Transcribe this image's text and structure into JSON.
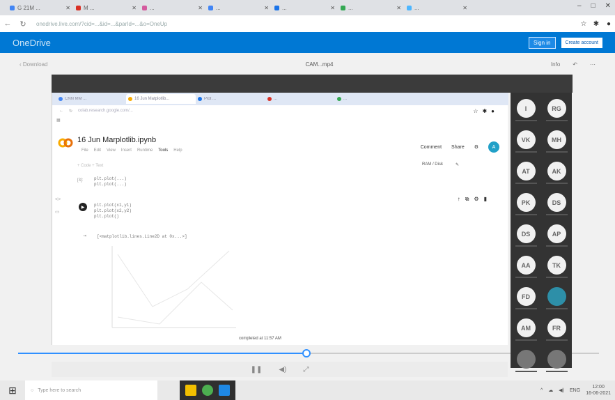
{
  "browser": {
    "tabs": [
      {
        "label": "G 21M ...",
        "color": "#4285f4"
      },
      {
        "label": "M ...",
        "color": "#d93025"
      },
      {
        "label": "...",
        "color": "#d45a9e"
      },
      {
        "label": "...",
        "color": "#4285f4"
      },
      {
        "label": "...",
        "color": "#1a73e8"
      },
      {
        "label": "...",
        "color": "#34a853"
      },
      {
        "label": "...",
        "color": "#4db6ff"
      }
    ],
    "url": "onedrive.live.com/?cid=...&id=...&parId=...&o=OneUp",
    "window_controls": {
      "minimize": "–",
      "restore": "□",
      "close": "✕"
    }
  },
  "onedrive": {
    "brand": "OneDrive",
    "sign_in": "Sign in",
    "create": "Create account"
  },
  "filebar": {
    "back": "‹ Download",
    "filename": "CAM...mp4",
    "info": "Info"
  },
  "inner": {
    "tabs": [
      "CNN MM ...",
      "16 Jun Matplotlib...",
      "Plot ...",
      "...",
      "..."
    ],
    "url": "colab.research.google.com/...",
    "notebook_title": "16 Jun Marplotlib.ipynb",
    "menus": [
      "File",
      "Edit",
      "View",
      "Insert",
      "Runtime",
      "Tools",
      "Help"
    ],
    "menu_strong": "Tools",
    "comment": "Comment",
    "share": "Share",
    "avatar": "A",
    "toolbar": "+ Code   + Text",
    "ram": "RAM / Disk",
    "cell1_num": "[3]:",
    "cell1_code": [
      "plt.plot(...)",
      "plt.plot(...)"
    ],
    "cell2_code": [
      "plt.plot(x1,y1)",
      "plt.plot(x2,y2)",
      "plt.plot()"
    ],
    "output_label": "[<matplotlib.lines.Line2D at 0x...>]",
    "status": "completed at 11:57 AM"
  },
  "participants": [
    "I",
    "RG",
    "VK",
    "MH",
    "AT",
    "AK",
    "PK",
    "DS",
    "DS",
    "AP",
    "AA",
    "TK",
    "FD",
    "",
    "AM",
    "FR",
    "",
    ""
  ],
  "taskbar": {
    "search": "Type here to search",
    "time": "12:00",
    "date": "16-06-2021",
    "lang": "ENG"
  }
}
